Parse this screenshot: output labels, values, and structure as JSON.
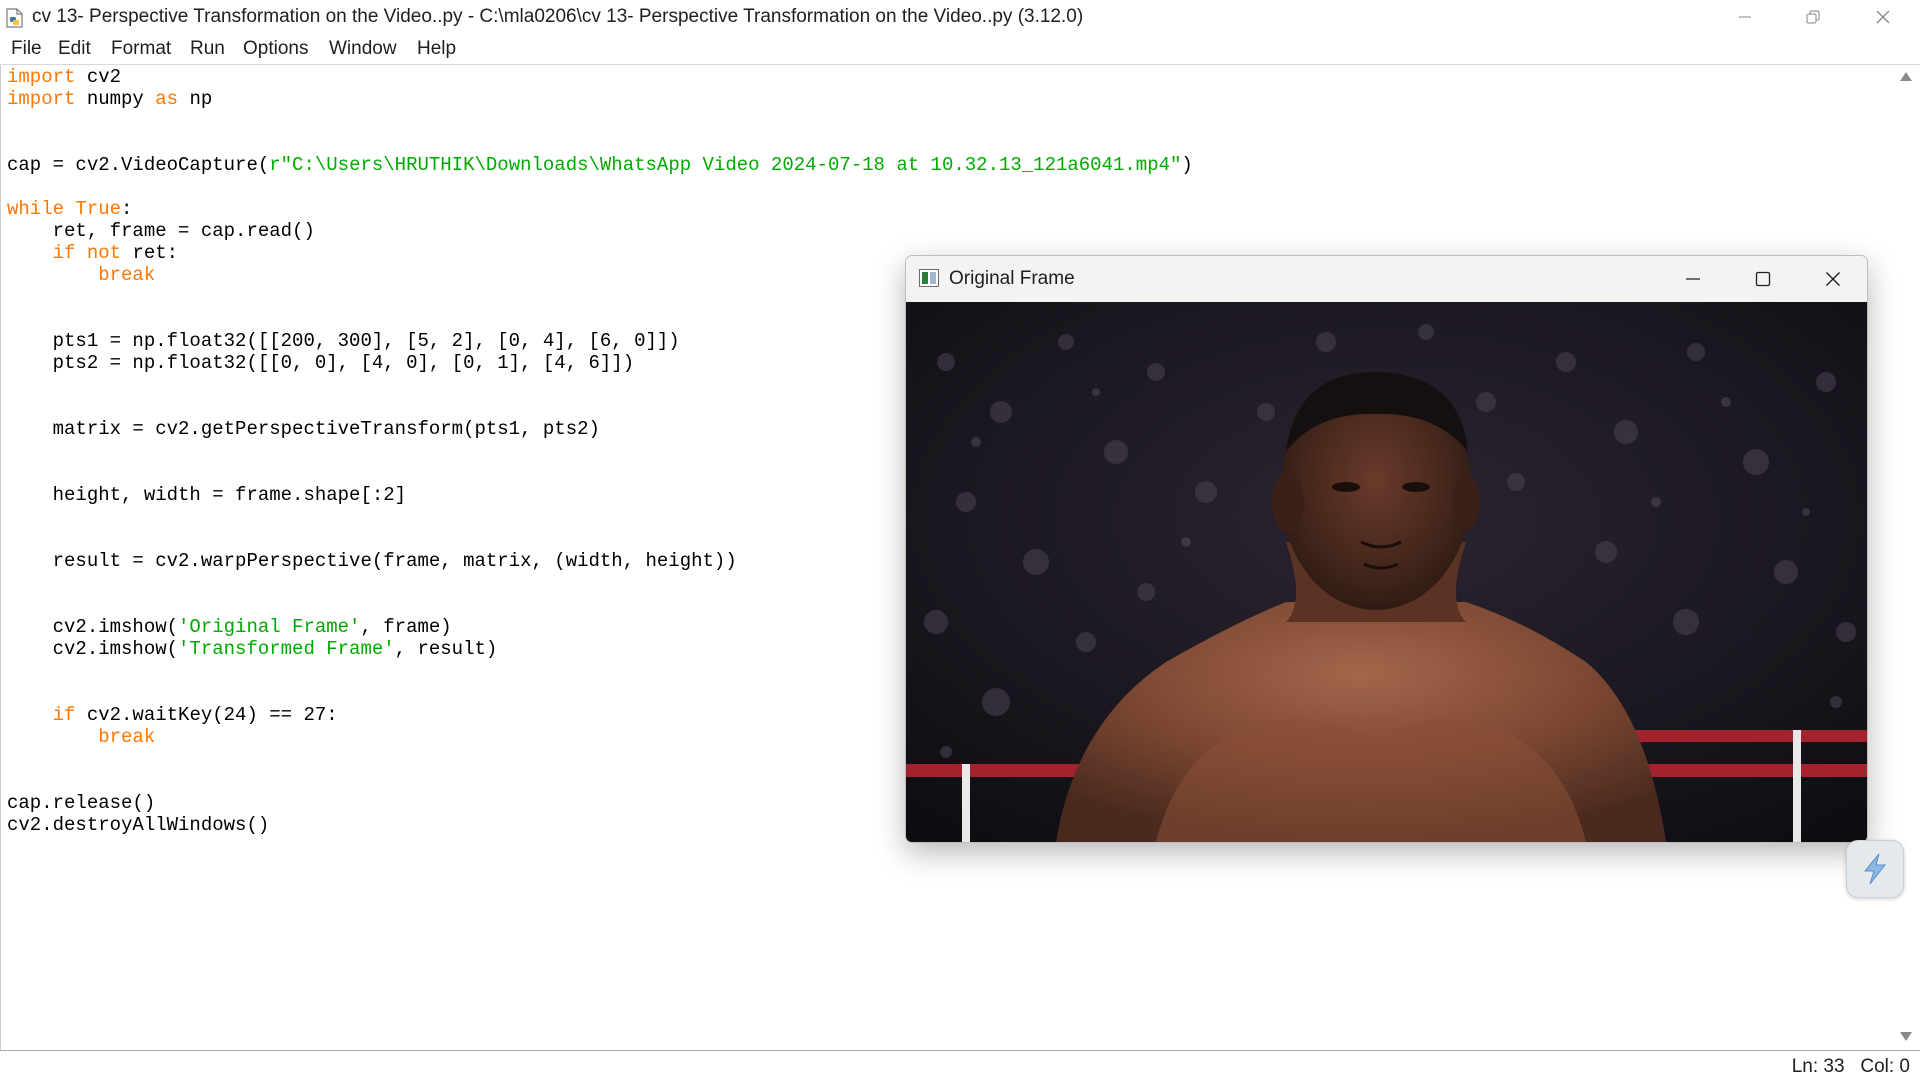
{
  "window": {
    "title": "cv 13- Perspective Transformation on the Video..py - C:\\mla0206\\cv 13- Perspective Transformation on the Video..py (3.12.0)",
    "icon": "python-file-icon",
    "controls": [
      "minimize-icon",
      "restore-icon",
      "close-icon"
    ]
  },
  "menu": {
    "items": [
      "File",
      "Edit",
      "Format",
      "Run",
      "Options",
      "Window",
      "Help"
    ]
  },
  "editor": {
    "lines": [
      [
        {
          "t": "import",
          "c": "kw"
        },
        {
          "t": " cv2"
        }
      ],
      [
        {
          "t": "import",
          "c": "kw"
        },
        {
          "t": " numpy "
        },
        {
          "t": "as",
          "c": "kw"
        },
        {
          "t": " np"
        }
      ],
      [],
      [],
      [
        {
          "t": "cap = cv2.VideoCapture("
        },
        {
          "t": "r\"C:\\Users\\HRUTHIK\\Downloads\\WhatsApp Video 2024-07-18 at 10.32.13_121a6041.mp4\"",
          "c": "str"
        },
        {
          "t": ")"
        }
      ],
      [],
      [
        {
          "t": "while",
          "c": "kw"
        },
        {
          "t": " "
        },
        {
          "t": "True",
          "c": "kw"
        },
        {
          "t": ":"
        }
      ],
      [
        {
          "t": "    ret, frame = cap.read()"
        }
      ],
      [
        {
          "t": "    "
        },
        {
          "t": "if",
          "c": "kw"
        },
        {
          "t": " "
        },
        {
          "t": "not",
          "c": "kw"
        },
        {
          "t": " ret:"
        }
      ],
      [
        {
          "t": "        "
        },
        {
          "t": "break",
          "c": "kw"
        }
      ],
      [],
      [],
      [
        {
          "t": "    pts1 = np.float32([[200, 300], [5, 2], [0, 4], [6, 0]])"
        }
      ],
      [
        {
          "t": "    pts2 = np.float32([[0, 0], [4, 0], [0, 1], [4, 6]])"
        }
      ],
      [],
      [],
      [
        {
          "t": "    matrix = cv2.getPerspectiveTransform(pts1, pts2)"
        }
      ],
      [],
      [],
      [
        {
          "t": "    height, width = frame.shape[:2]"
        }
      ],
      [],
      [],
      [
        {
          "t": "    result = cv2.warpPerspective(frame, matrix, (width, height))"
        }
      ],
      [],
      [],
      [
        {
          "t": "    cv2.imshow("
        },
        {
          "t": "'Original Frame'",
          "c": "str"
        },
        {
          "t": ", frame)"
        }
      ],
      [
        {
          "t": "    cv2.imshow("
        },
        {
          "t": "'Transformed Frame'",
          "c": "str"
        },
        {
          "t": ", result)"
        }
      ],
      [],
      [],
      [
        {
          "t": "    "
        },
        {
          "t": "if",
          "c": "kw"
        },
        {
          "t": " cv2.waitKey(24) == 27:"
        }
      ],
      [
        {
          "t": "        "
        },
        {
          "t": "break",
          "c": "kw"
        }
      ],
      [],
      [],
      [
        {
          "t": "cap.release()"
        }
      ],
      [
        {
          "t": "cv2.destroyAllWindows()"
        }
      ]
    ]
  },
  "status": {
    "position": "Ln: 33   Col: 0"
  },
  "cv_window": {
    "title": "Original Frame",
    "icon": "opencv-window-icon",
    "controls": [
      "minimize-icon",
      "maximize-icon",
      "close-icon"
    ]
  },
  "floating_badge": {
    "icon": "lightning-bolt-icon"
  },
  "colors": {
    "keyword": "#ff7700",
    "string": "#00aa00",
    "text": "#000000"
  }
}
